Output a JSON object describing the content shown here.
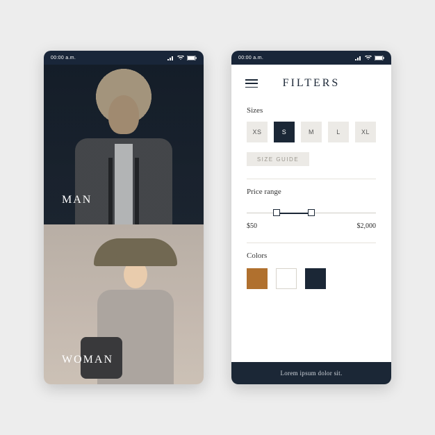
{
  "status": {
    "time": "00:00 a.m."
  },
  "categories": {
    "man": "MAN",
    "woman": "WOMAN"
  },
  "filters": {
    "title": "FILTERS",
    "sizes_label": "Sizes",
    "sizes": [
      "XS",
      "S",
      "M",
      "L",
      "XL"
    ],
    "active_size": "S",
    "size_guide": "SIZE GUIDE",
    "price_label": "Price range",
    "price_min": "$50",
    "price_max": "$2,000",
    "colors_label": "Colors",
    "colors": [
      "#b0702e",
      "#ffffff",
      "#1b2736"
    ]
  },
  "footer": "Lorem ipsum dolor sit."
}
